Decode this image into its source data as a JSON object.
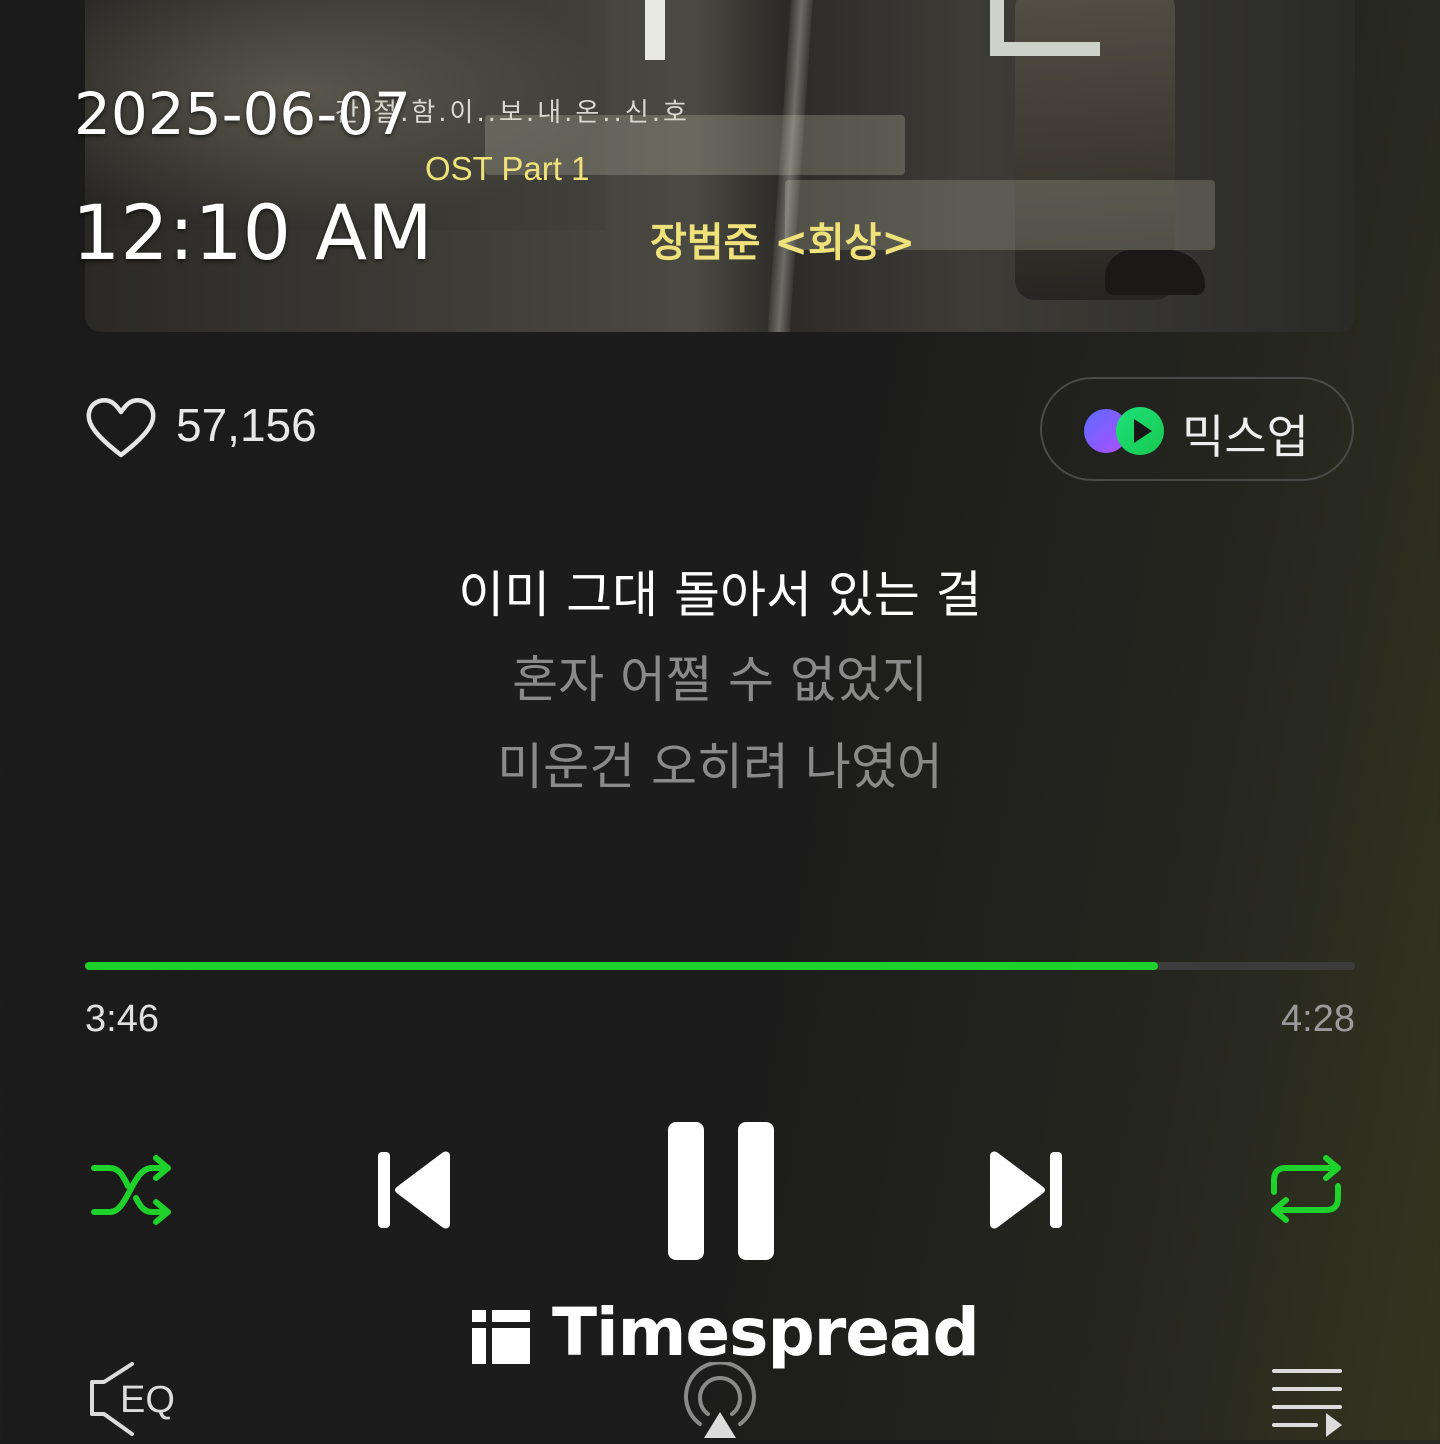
{
  "overlay": {
    "date": "2025-06-07",
    "time": "12:10 AM"
  },
  "album_art": {
    "subtitle": "간.절.함.이..보.내.온..신.호",
    "ost_label": "OST Part 1",
    "artist_title": "장범준 <회상>"
  },
  "like": {
    "icon": "heart-icon",
    "count": "57,156"
  },
  "mixup": {
    "icon": "mixup-logo-icon",
    "label": "믹스업"
  },
  "lyrics": [
    "이미 그대 돌아서 있는 걸",
    "혼자 어쩔 수 없었지",
    "미운건 오히려 나였어"
  ],
  "player": {
    "current_time": "3:46",
    "total_time": "4:28",
    "progress_fraction": 0.845,
    "state": "playing"
  },
  "controls": {
    "shuffle_icon": "shuffle-icon",
    "prev_icon": "skip-previous-icon",
    "pause_icon": "pause-icon",
    "next_icon": "skip-next-icon",
    "repeat_icon": "repeat-icon",
    "eq_icon": "eq-speaker-icon",
    "cast_icon": "airplay-icon",
    "playlist_icon": "playlist-icon"
  },
  "colors": {
    "accent": "#1ed12b",
    "art_text": "#f0e27a"
  },
  "watermark": {
    "text": "Timespread"
  }
}
